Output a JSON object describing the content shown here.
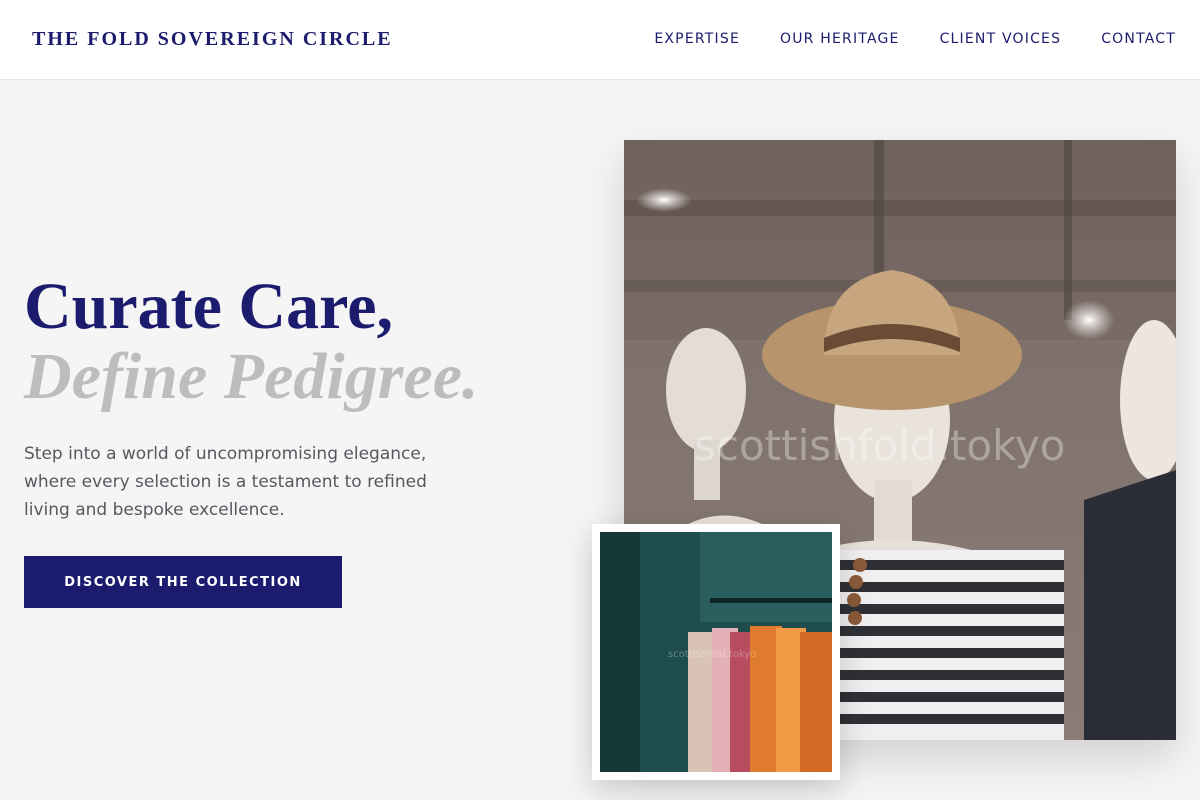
{
  "brand": {
    "name": "THE FOLD SOVEREIGN CIRCLE"
  },
  "nav": {
    "items": [
      {
        "label": "EXPERTISE"
      },
      {
        "label": "OUR HERITAGE"
      },
      {
        "label": "CLIENT VOICES"
      },
      {
        "label": "CONTACT"
      }
    ]
  },
  "hero": {
    "title_line1": "Curate Care,",
    "title_line2": "Define Pedigree.",
    "lead": "Step into a world of uncompromising elegance, where every selection is a testament to refined living and bespoke excellence.",
    "cta_label": "DISCOVER THE COLLECTION"
  },
  "images": {
    "watermark": "scottishfold.tokyo",
    "inset_watermark": "scottishfold.tokyo"
  },
  "colors": {
    "brand": "#1c1c6e",
    "title_muted": "#bdbdbd",
    "body_text": "#55595f",
    "page_bg": "#f5f5f5"
  }
}
